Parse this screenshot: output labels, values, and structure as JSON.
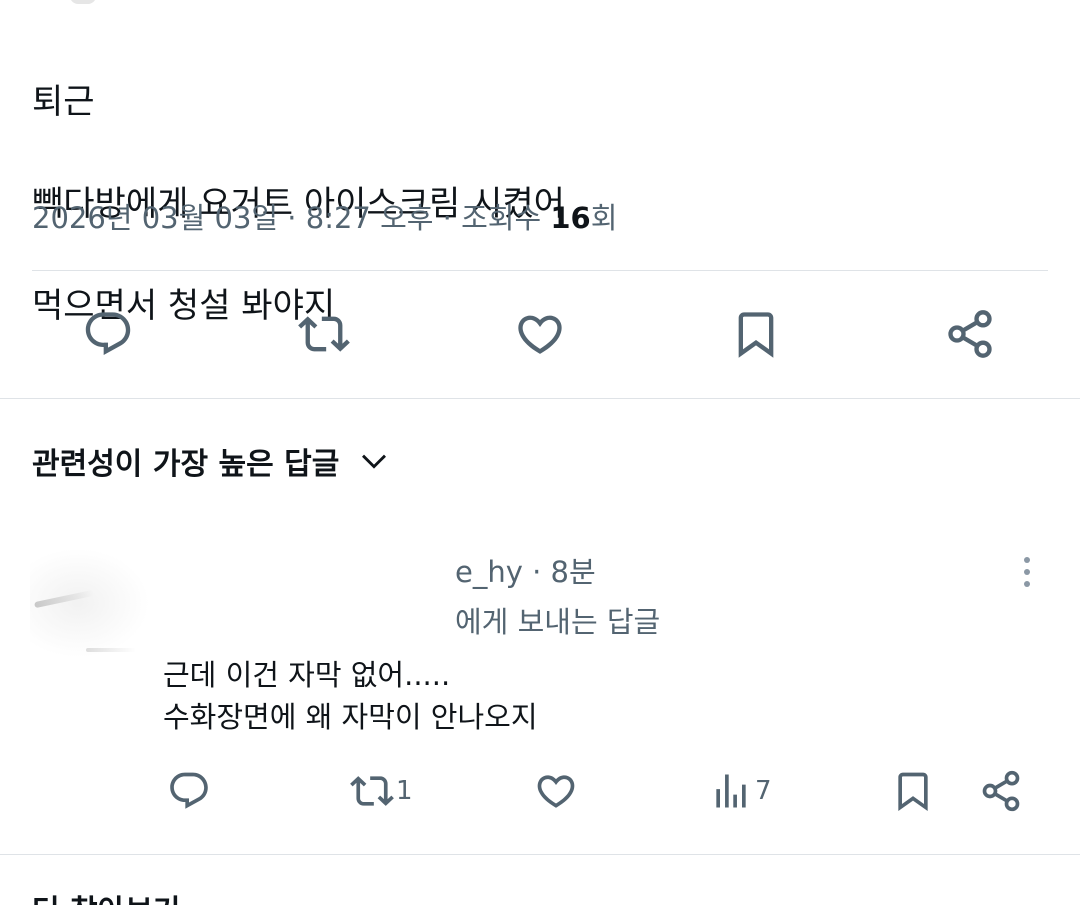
{
  "tweet": {
    "lines": [
      "퇴근",
      "빽다방에게 요거트 아이스크림 시켰어",
      "먹으면서 청설 봐야지"
    ],
    "meta_prefix": "2026년 03월 03일 · 8:27 오후 · 조회수 ",
    "views_count": "16",
    "views_suffix": "회"
  },
  "actions": {
    "icons": [
      "reply-icon",
      "retweet-icon",
      "like-icon",
      "bookmark-icon",
      "share-icon"
    ]
  },
  "replies_sort": {
    "label": "관련성이 가장 높은 답글"
  },
  "reply": {
    "handle": "e_hy",
    "time": " · 8분",
    "replying_to": "에게 보내는 답글",
    "lines": [
      "근데 이건 자막 없어.....",
      "수화장면에 왜 자막이 안나오지"
    ],
    "retweet_count": "1",
    "views_count": "7"
  },
  "next_section": {
    "label": "더 찾아보기"
  },
  "colors": {
    "text": "#0f1419",
    "secondary": "#536471",
    "icon": "#536471",
    "divider": "#dfe3e7"
  }
}
